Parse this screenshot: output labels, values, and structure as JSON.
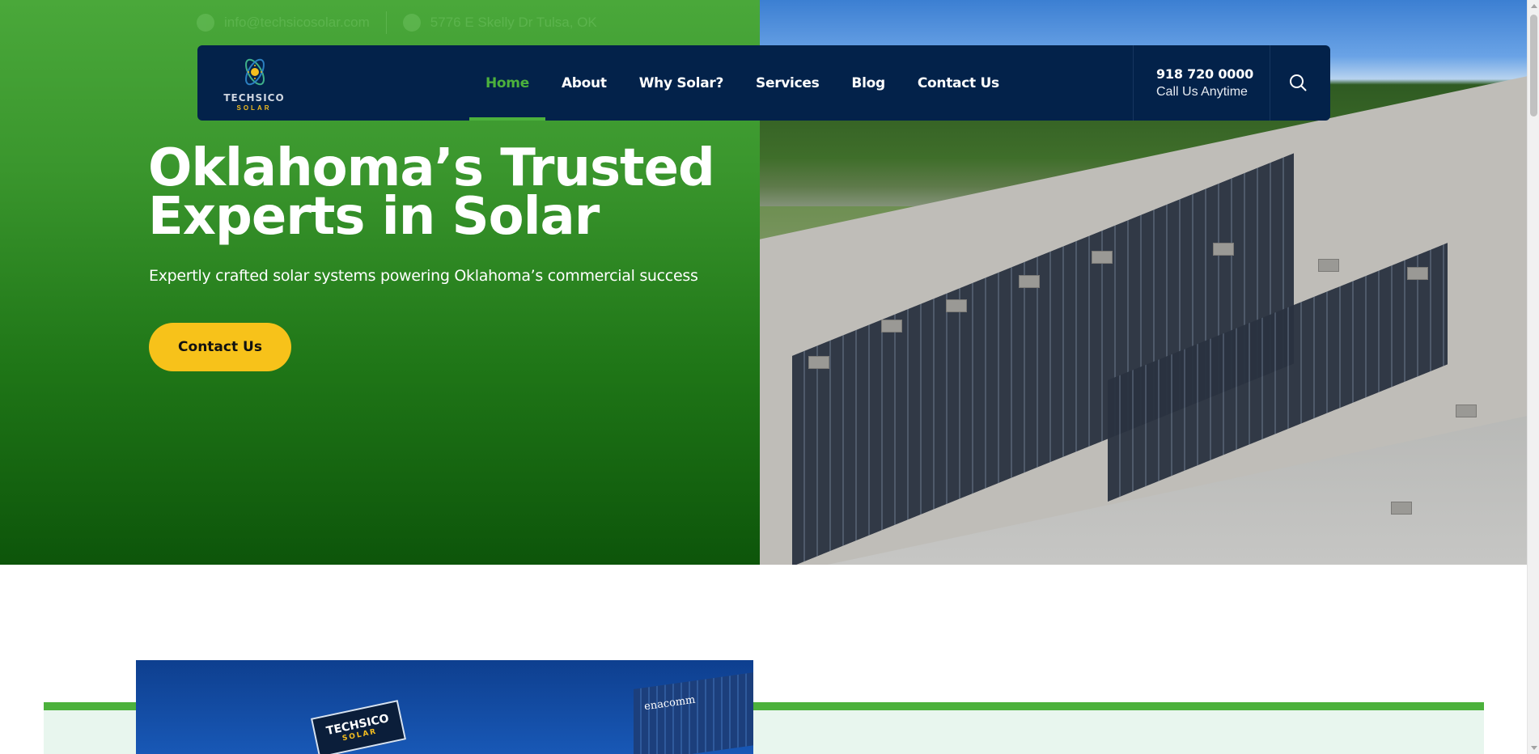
{
  "topbar": {
    "email": "info@techsicosolar.com",
    "address": "5776 E Skelly Dr Tulsa, OK"
  },
  "logo": {
    "brand": "TECHSICO",
    "sub": "SOLAR"
  },
  "nav": {
    "items": [
      {
        "label": "Home",
        "active": true
      },
      {
        "label": "About",
        "active": false
      },
      {
        "label": "Why Solar?",
        "active": false
      },
      {
        "label": "Services",
        "active": false
      },
      {
        "label": "Blog",
        "active": false
      },
      {
        "label": "Contact Us",
        "active": false
      }
    ]
  },
  "phone": {
    "number": "918 720 0000",
    "caption": "Call Us Anytime"
  },
  "hero": {
    "title": "Oklahoma’s Trusted Experts in Solar",
    "subtitle": "Expertly crafted solar systems powering Oklahoma’s commercial success",
    "cta_label": "Contact Us"
  },
  "preview": {
    "sign_brand": "TECHSICO",
    "sign_sub": "SOLAR",
    "building_name": "enacomm"
  },
  "colors": {
    "brand_green": "#4cb13c",
    "navy": "#03224a",
    "cta_yellow": "#f7c21a",
    "mint": "#e8f6ee"
  },
  "icons": {
    "email": "envelope-icon",
    "address": "location-pin-icon",
    "search": "search-icon"
  }
}
